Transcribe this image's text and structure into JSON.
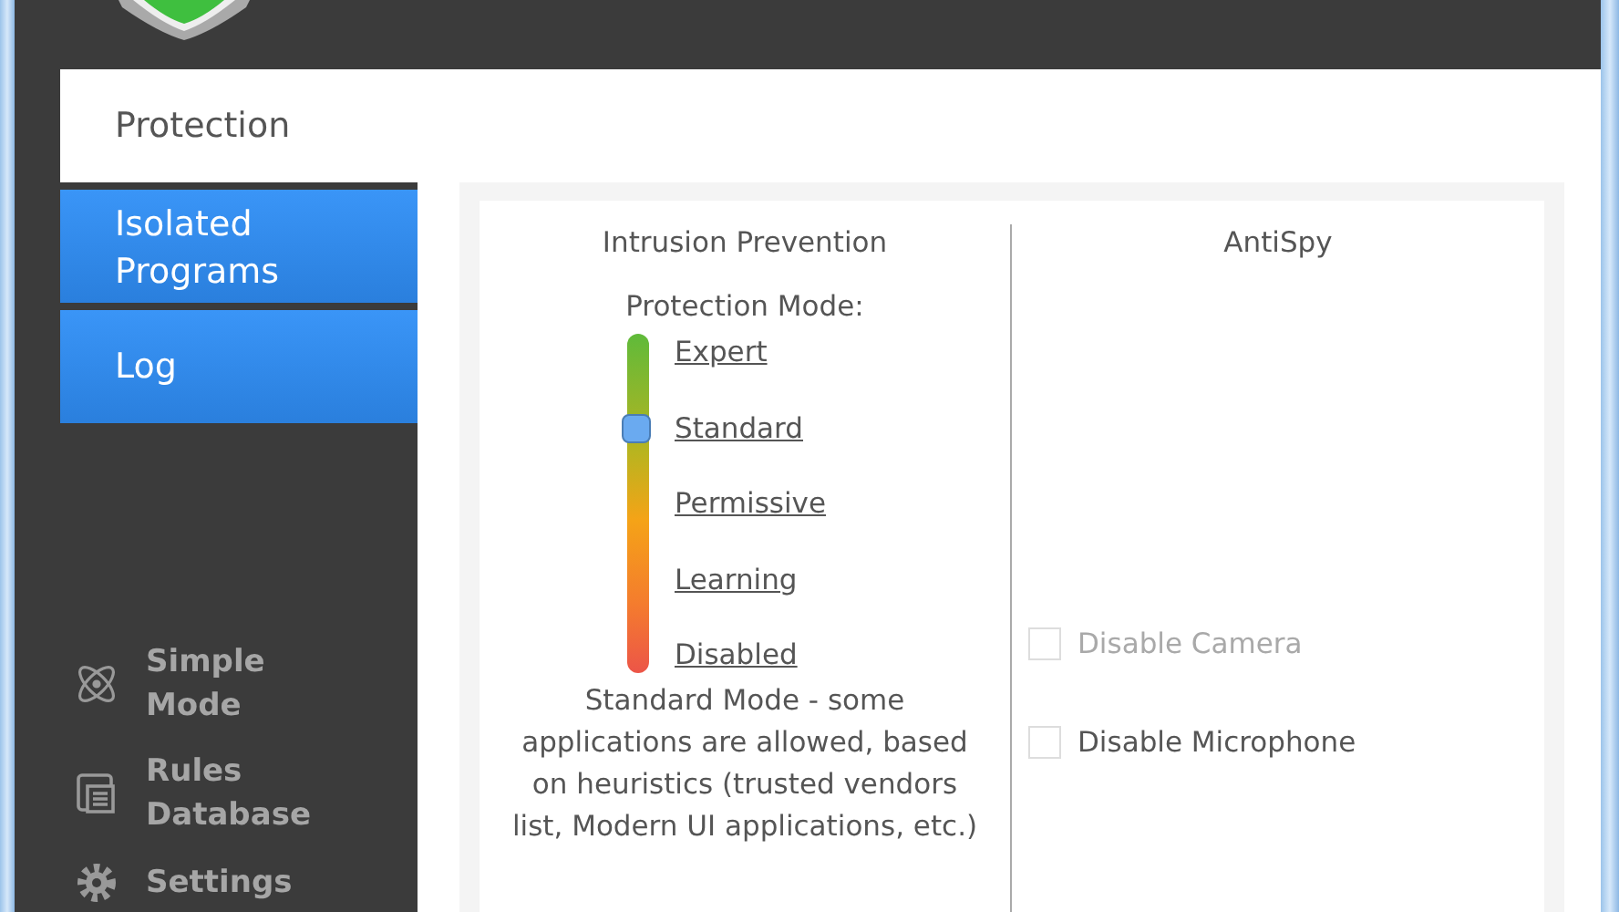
{
  "page_title": "Protection",
  "sidebar": {
    "items": [
      {
        "label": "Isolated Programs",
        "selected": false
      },
      {
        "label": "Log",
        "selected": false
      }
    ],
    "bottom_items": [
      {
        "label": "Simple Mode",
        "kind": "atom"
      },
      {
        "label": "Rules Database",
        "kind": "database"
      },
      {
        "label": "Settings",
        "kind": "gear"
      }
    ]
  },
  "intrusion": {
    "title": "Intrusion Prevention",
    "mode_label": "Protection Mode:",
    "slider": {
      "level": 0.75
    },
    "modes": [
      "Expert",
      "Standard",
      "Permissive",
      "Learning",
      "Disabled"
    ],
    "description": "Standard Mode - some applications are allowed, based on heuristics (trusted vendors list, Modern UI applications, etc.)"
  },
  "antispy": {
    "title": "AntiSpy",
    "options": [
      {
        "label": "Disable Camera",
        "checked": false,
        "disabled": true
      },
      {
        "label": "Disable Microphone",
        "checked": false,
        "disabled": false
      }
    ]
  }
}
